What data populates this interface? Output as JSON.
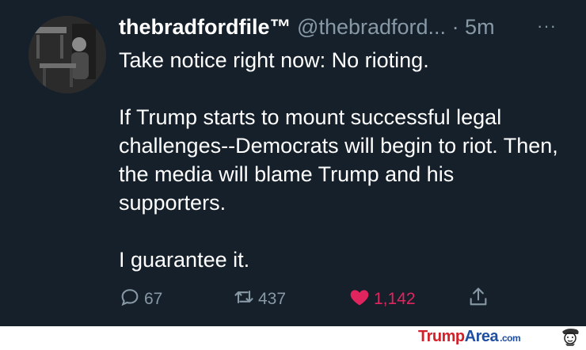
{
  "tweet": {
    "display_name": "thebradfordfile™",
    "handle": "@thebradford...",
    "time": "· 5m",
    "more": "···",
    "paragraphs": [
      "Take notice right now: No rioting.",
      "If Trump starts to mount successful legal challenges--Democrats will begin to riot. Then, the media will blame Trump and his supporters.",
      "I guarantee it."
    ],
    "replies": "67",
    "retweets": "437",
    "likes": "1,142"
  },
  "watermark": {
    "brand_part1": "Trump",
    "brand_part2": "Area",
    "brand_suffix": ".com"
  },
  "colors": {
    "background": "#15202b",
    "secondary_text": "#8899a6",
    "like": "#e0245e"
  }
}
